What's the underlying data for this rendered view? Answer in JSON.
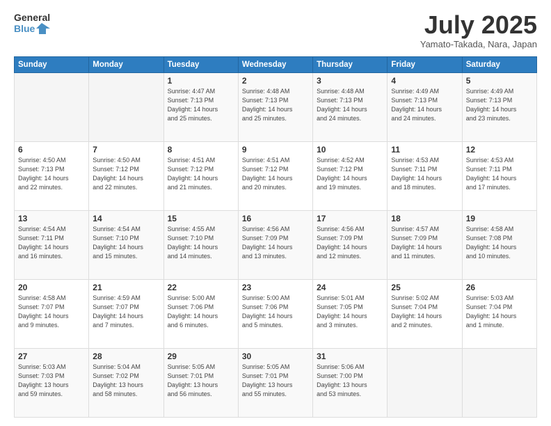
{
  "header": {
    "logo_line1": "General",
    "logo_line2": "Blue",
    "title": "July 2025",
    "subtitle": "Yamato-Takada, Nara, Japan"
  },
  "weekdays": [
    "Sunday",
    "Monday",
    "Tuesday",
    "Wednesday",
    "Thursday",
    "Friday",
    "Saturday"
  ],
  "weeks": [
    [
      {
        "day": "",
        "detail": ""
      },
      {
        "day": "",
        "detail": ""
      },
      {
        "day": "1",
        "detail": "Sunrise: 4:47 AM\nSunset: 7:13 PM\nDaylight: 14 hours\nand 25 minutes."
      },
      {
        "day": "2",
        "detail": "Sunrise: 4:48 AM\nSunset: 7:13 PM\nDaylight: 14 hours\nand 25 minutes."
      },
      {
        "day": "3",
        "detail": "Sunrise: 4:48 AM\nSunset: 7:13 PM\nDaylight: 14 hours\nand 24 minutes."
      },
      {
        "day": "4",
        "detail": "Sunrise: 4:49 AM\nSunset: 7:13 PM\nDaylight: 14 hours\nand 24 minutes."
      },
      {
        "day": "5",
        "detail": "Sunrise: 4:49 AM\nSunset: 7:13 PM\nDaylight: 14 hours\nand 23 minutes."
      }
    ],
    [
      {
        "day": "6",
        "detail": "Sunrise: 4:50 AM\nSunset: 7:13 PM\nDaylight: 14 hours\nand 22 minutes."
      },
      {
        "day": "7",
        "detail": "Sunrise: 4:50 AM\nSunset: 7:12 PM\nDaylight: 14 hours\nand 22 minutes."
      },
      {
        "day": "8",
        "detail": "Sunrise: 4:51 AM\nSunset: 7:12 PM\nDaylight: 14 hours\nand 21 minutes."
      },
      {
        "day": "9",
        "detail": "Sunrise: 4:51 AM\nSunset: 7:12 PM\nDaylight: 14 hours\nand 20 minutes."
      },
      {
        "day": "10",
        "detail": "Sunrise: 4:52 AM\nSunset: 7:12 PM\nDaylight: 14 hours\nand 19 minutes."
      },
      {
        "day": "11",
        "detail": "Sunrise: 4:53 AM\nSunset: 7:11 PM\nDaylight: 14 hours\nand 18 minutes."
      },
      {
        "day": "12",
        "detail": "Sunrise: 4:53 AM\nSunset: 7:11 PM\nDaylight: 14 hours\nand 17 minutes."
      }
    ],
    [
      {
        "day": "13",
        "detail": "Sunrise: 4:54 AM\nSunset: 7:11 PM\nDaylight: 14 hours\nand 16 minutes."
      },
      {
        "day": "14",
        "detail": "Sunrise: 4:54 AM\nSunset: 7:10 PM\nDaylight: 14 hours\nand 15 minutes."
      },
      {
        "day": "15",
        "detail": "Sunrise: 4:55 AM\nSunset: 7:10 PM\nDaylight: 14 hours\nand 14 minutes."
      },
      {
        "day": "16",
        "detail": "Sunrise: 4:56 AM\nSunset: 7:09 PM\nDaylight: 14 hours\nand 13 minutes."
      },
      {
        "day": "17",
        "detail": "Sunrise: 4:56 AM\nSunset: 7:09 PM\nDaylight: 14 hours\nand 12 minutes."
      },
      {
        "day": "18",
        "detail": "Sunrise: 4:57 AM\nSunset: 7:09 PM\nDaylight: 14 hours\nand 11 minutes."
      },
      {
        "day": "19",
        "detail": "Sunrise: 4:58 AM\nSunset: 7:08 PM\nDaylight: 14 hours\nand 10 minutes."
      }
    ],
    [
      {
        "day": "20",
        "detail": "Sunrise: 4:58 AM\nSunset: 7:07 PM\nDaylight: 14 hours\nand 9 minutes."
      },
      {
        "day": "21",
        "detail": "Sunrise: 4:59 AM\nSunset: 7:07 PM\nDaylight: 14 hours\nand 7 minutes."
      },
      {
        "day": "22",
        "detail": "Sunrise: 5:00 AM\nSunset: 7:06 PM\nDaylight: 14 hours\nand 6 minutes."
      },
      {
        "day": "23",
        "detail": "Sunrise: 5:00 AM\nSunset: 7:06 PM\nDaylight: 14 hours\nand 5 minutes."
      },
      {
        "day": "24",
        "detail": "Sunrise: 5:01 AM\nSunset: 7:05 PM\nDaylight: 14 hours\nand 3 minutes."
      },
      {
        "day": "25",
        "detail": "Sunrise: 5:02 AM\nSunset: 7:04 PM\nDaylight: 14 hours\nand 2 minutes."
      },
      {
        "day": "26",
        "detail": "Sunrise: 5:03 AM\nSunset: 7:04 PM\nDaylight: 14 hours\nand 1 minute."
      }
    ],
    [
      {
        "day": "27",
        "detail": "Sunrise: 5:03 AM\nSunset: 7:03 PM\nDaylight: 13 hours\nand 59 minutes."
      },
      {
        "day": "28",
        "detail": "Sunrise: 5:04 AM\nSunset: 7:02 PM\nDaylight: 13 hours\nand 58 minutes."
      },
      {
        "day": "29",
        "detail": "Sunrise: 5:05 AM\nSunset: 7:01 PM\nDaylight: 13 hours\nand 56 minutes."
      },
      {
        "day": "30",
        "detail": "Sunrise: 5:05 AM\nSunset: 7:01 PM\nDaylight: 13 hours\nand 55 minutes."
      },
      {
        "day": "31",
        "detail": "Sunrise: 5:06 AM\nSunset: 7:00 PM\nDaylight: 13 hours\nand 53 minutes."
      },
      {
        "day": "",
        "detail": ""
      },
      {
        "day": "",
        "detail": ""
      }
    ]
  ]
}
